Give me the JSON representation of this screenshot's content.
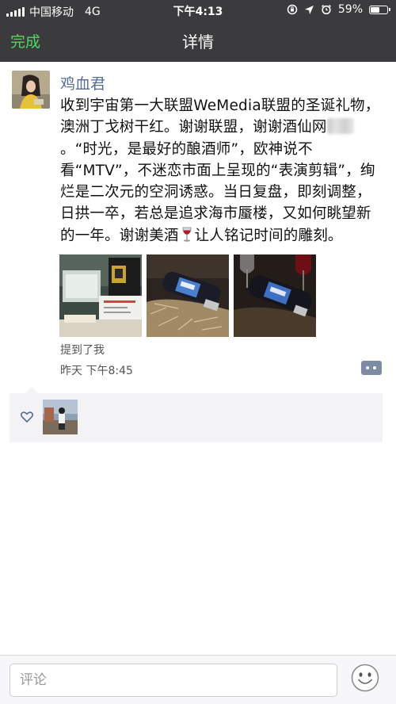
{
  "status_bar": {
    "carrier": "中国移动",
    "network": "4G",
    "time": "下午4:13",
    "battery": "59%",
    "battery_level": 0.59
  },
  "nav": {
    "back_label": "完成",
    "title": "详情"
  },
  "post": {
    "username": "鸡血君",
    "text_part1": "收到宇宙第一大联盟WeMedia联盟的圣诞礼物，澳洲丁戈树干红。谢谢联盟，谢谢酒仙网",
    "text_part2": "。“时光，是最好的酿酒师”，欧神说不看“MTV”，不迷恋市面上呈现的“表演剪辑”，绚烂是二次元的空洞诱惑。当日复盘，即刻调整，日拱一卒，若总是追求海市蜃楼，又如何眺望新的一年。谢谢美酒",
    "text_part3": "让人铭记时间的雕刻。",
    "mentioned": "提到了我",
    "timestamp": "昨天 下午8:45"
  },
  "comment_bar": {
    "placeholder": "评论"
  },
  "colors": {
    "nav_bg": "#3b3b3d",
    "accent_green": "#4cd964",
    "link_blue": "#576b95",
    "likes_bg": "#f3f3f5"
  }
}
